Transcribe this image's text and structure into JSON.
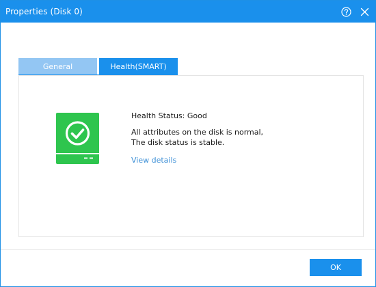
{
  "window": {
    "title": "Properties (Disk 0)"
  },
  "titlebar_icons": [
    "help-icon",
    "close-icon"
  ],
  "tabs": [
    {
      "label": "General",
      "active": false
    },
    {
      "label": "Health(SMART)",
      "active": true
    }
  ],
  "health": {
    "status": "Health Status: Good",
    "description_line1": "All attributes on the disk is normal,",
    "description_line2": "The disk status is stable.",
    "link": "View details",
    "icon": "disk-health-good-icon"
  },
  "footer": {
    "ok_label": "OK"
  },
  "colors": {
    "accent": "#1a90ec",
    "inactive_tab": "#93c6f3",
    "health_good": "#2ec54e",
    "link": "#3c8fd6"
  }
}
